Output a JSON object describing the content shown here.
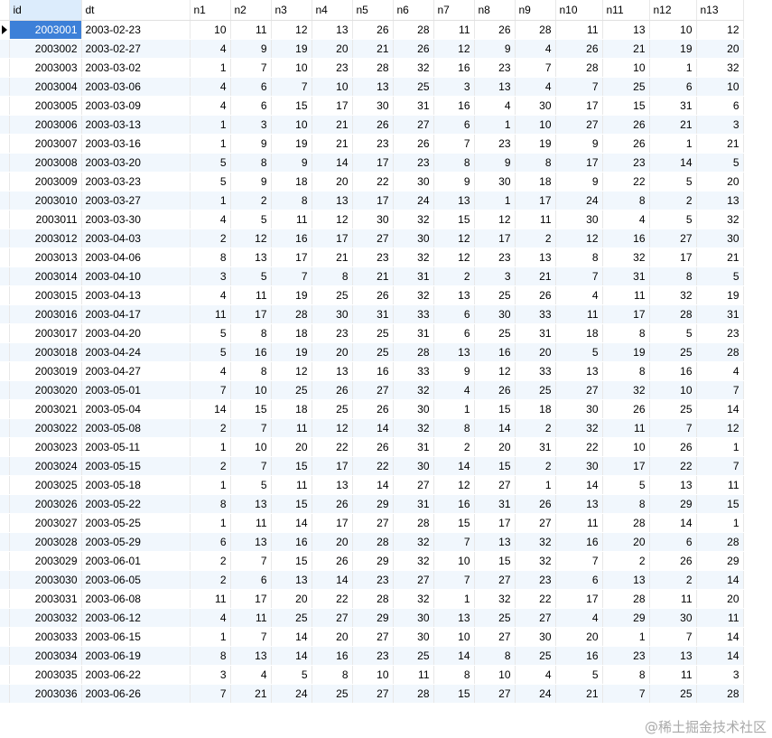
{
  "columns": [
    "id",
    "dt",
    "n1",
    "n2",
    "n3",
    "n4",
    "n5",
    "n6",
    "n7",
    "n8",
    "n9",
    "n10",
    "n11",
    "n12",
    "n13"
  ],
  "selected_row": 0,
  "rows": [
    [
      "2003001",
      "2003-02-23",
      "10",
      "11",
      "12",
      "13",
      "26",
      "28",
      "11",
      "26",
      "28",
      "11",
      "13",
      "10",
      "12"
    ],
    [
      "2003002",
      "2003-02-27",
      "4",
      "9",
      "19",
      "20",
      "21",
      "26",
      "12",
      "9",
      "4",
      "26",
      "21",
      "19",
      "20"
    ],
    [
      "2003003",
      "2003-03-02",
      "1",
      "7",
      "10",
      "23",
      "28",
      "32",
      "16",
      "23",
      "7",
      "28",
      "10",
      "1",
      "32"
    ],
    [
      "2003004",
      "2003-03-06",
      "4",
      "6",
      "7",
      "10",
      "13",
      "25",
      "3",
      "13",
      "4",
      "7",
      "25",
      "6",
      "10"
    ],
    [
      "2003005",
      "2003-03-09",
      "4",
      "6",
      "15",
      "17",
      "30",
      "31",
      "16",
      "4",
      "30",
      "17",
      "15",
      "31",
      "6"
    ],
    [
      "2003006",
      "2003-03-13",
      "1",
      "3",
      "10",
      "21",
      "26",
      "27",
      "6",
      "1",
      "10",
      "27",
      "26",
      "21",
      "3"
    ],
    [
      "2003007",
      "2003-03-16",
      "1",
      "9",
      "19",
      "21",
      "23",
      "26",
      "7",
      "23",
      "19",
      "9",
      "26",
      "1",
      "21"
    ],
    [
      "2003008",
      "2003-03-20",
      "5",
      "8",
      "9",
      "14",
      "17",
      "23",
      "8",
      "9",
      "8",
      "17",
      "23",
      "14",
      "5"
    ],
    [
      "2003009",
      "2003-03-23",
      "5",
      "9",
      "18",
      "20",
      "22",
      "30",
      "9",
      "30",
      "18",
      "9",
      "22",
      "5",
      "20"
    ],
    [
      "2003010",
      "2003-03-27",
      "1",
      "2",
      "8",
      "13",
      "17",
      "24",
      "13",
      "1",
      "17",
      "24",
      "8",
      "2",
      "13"
    ],
    [
      "2003011",
      "2003-03-30",
      "4",
      "5",
      "11",
      "12",
      "30",
      "32",
      "15",
      "12",
      "11",
      "30",
      "4",
      "5",
      "32"
    ],
    [
      "2003012",
      "2003-04-03",
      "2",
      "12",
      "16",
      "17",
      "27",
      "30",
      "12",
      "17",
      "2",
      "12",
      "16",
      "27",
      "30"
    ],
    [
      "2003013",
      "2003-04-06",
      "8",
      "13",
      "17",
      "21",
      "23",
      "32",
      "12",
      "23",
      "13",
      "8",
      "32",
      "17",
      "21"
    ],
    [
      "2003014",
      "2003-04-10",
      "3",
      "5",
      "7",
      "8",
      "21",
      "31",
      "2",
      "3",
      "21",
      "7",
      "31",
      "8",
      "5"
    ],
    [
      "2003015",
      "2003-04-13",
      "4",
      "11",
      "19",
      "25",
      "26",
      "32",
      "13",
      "25",
      "26",
      "4",
      "11",
      "32",
      "19"
    ],
    [
      "2003016",
      "2003-04-17",
      "11",
      "17",
      "28",
      "30",
      "31",
      "33",
      "6",
      "30",
      "33",
      "11",
      "17",
      "28",
      "31"
    ],
    [
      "2003017",
      "2003-04-20",
      "5",
      "8",
      "18",
      "23",
      "25",
      "31",
      "6",
      "25",
      "31",
      "18",
      "8",
      "5",
      "23"
    ],
    [
      "2003018",
      "2003-04-24",
      "5",
      "16",
      "19",
      "20",
      "25",
      "28",
      "13",
      "16",
      "20",
      "5",
      "19",
      "25",
      "28"
    ],
    [
      "2003019",
      "2003-04-27",
      "4",
      "8",
      "12",
      "13",
      "16",
      "33",
      "9",
      "12",
      "33",
      "13",
      "8",
      "16",
      "4"
    ],
    [
      "2003020",
      "2003-05-01",
      "7",
      "10",
      "25",
      "26",
      "27",
      "32",
      "4",
      "26",
      "25",
      "27",
      "32",
      "10",
      "7"
    ],
    [
      "2003021",
      "2003-05-04",
      "14",
      "15",
      "18",
      "25",
      "26",
      "30",
      "1",
      "15",
      "18",
      "30",
      "26",
      "25",
      "14"
    ],
    [
      "2003022",
      "2003-05-08",
      "2",
      "7",
      "11",
      "12",
      "14",
      "32",
      "8",
      "14",
      "2",
      "32",
      "11",
      "7",
      "12"
    ],
    [
      "2003023",
      "2003-05-11",
      "1",
      "10",
      "20",
      "22",
      "26",
      "31",
      "2",
      "20",
      "31",
      "22",
      "10",
      "26",
      "1"
    ],
    [
      "2003024",
      "2003-05-15",
      "2",
      "7",
      "15",
      "17",
      "22",
      "30",
      "14",
      "15",
      "2",
      "30",
      "17",
      "22",
      "7"
    ],
    [
      "2003025",
      "2003-05-18",
      "1",
      "5",
      "11",
      "13",
      "14",
      "27",
      "12",
      "27",
      "1",
      "14",
      "5",
      "13",
      "11"
    ],
    [
      "2003026",
      "2003-05-22",
      "8",
      "13",
      "15",
      "26",
      "29",
      "31",
      "16",
      "31",
      "26",
      "13",
      "8",
      "29",
      "15"
    ],
    [
      "2003027",
      "2003-05-25",
      "1",
      "11",
      "14",
      "17",
      "27",
      "28",
      "15",
      "17",
      "27",
      "11",
      "28",
      "14",
      "1"
    ],
    [
      "2003028",
      "2003-05-29",
      "6",
      "13",
      "16",
      "20",
      "28",
      "32",
      "7",
      "13",
      "32",
      "16",
      "20",
      "6",
      "28"
    ],
    [
      "2003029",
      "2003-06-01",
      "2",
      "7",
      "15",
      "26",
      "29",
      "32",
      "10",
      "15",
      "32",
      "7",
      "2",
      "26",
      "29"
    ],
    [
      "2003030",
      "2003-06-05",
      "2",
      "6",
      "13",
      "14",
      "23",
      "27",
      "7",
      "27",
      "23",
      "6",
      "13",
      "2",
      "14"
    ],
    [
      "2003031",
      "2003-06-08",
      "11",
      "17",
      "20",
      "22",
      "28",
      "32",
      "1",
      "32",
      "22",
      "17",
      "28",
      "11",
      "20"
    ],
    [
      "2003032",
      "2003-06-12",
      "4",
      "11",
      "25",
      "27",
      "29",
      "30",
      "13",
      "25",
      "27",
      "4",
      "29",
      "30",
      "11"
    ],
    [
      "2003033",
      "2003-06-15",
      "1",
      "7",
      "14",
      "20",
      "27",
      "30",
      "10",
      "27",
      "30",
      "20",
      "1",
      "7",
      "14"
    ],
    [
      "2003034",
      "2003-06-19",
      "8",
      "13",
      "14",
      "16",
      "23",
      "25",
      "14",
      "8",
      "25",
      "16",
      "23",
      "13",
      "14"
    ],
    [
      "2003035",
      "2003-06-22",
      "3",
      "4",
      "5",
      "8",
      "10",
      "11",
      "8",
      "10",
      "4",
      "5",
      "8",
      "11",
      "3"
    ],
    [
      "2003036",
      "2003-06-26",
      "7",
      "21",
      "24",
      "25",
      "27",
      "28",
      "15",
      "27",
      "24",
      "21",
      "7",
      "25",
      "28"
    ]
  ],
  "watermark": "@稀土掘金技术社区"
}
